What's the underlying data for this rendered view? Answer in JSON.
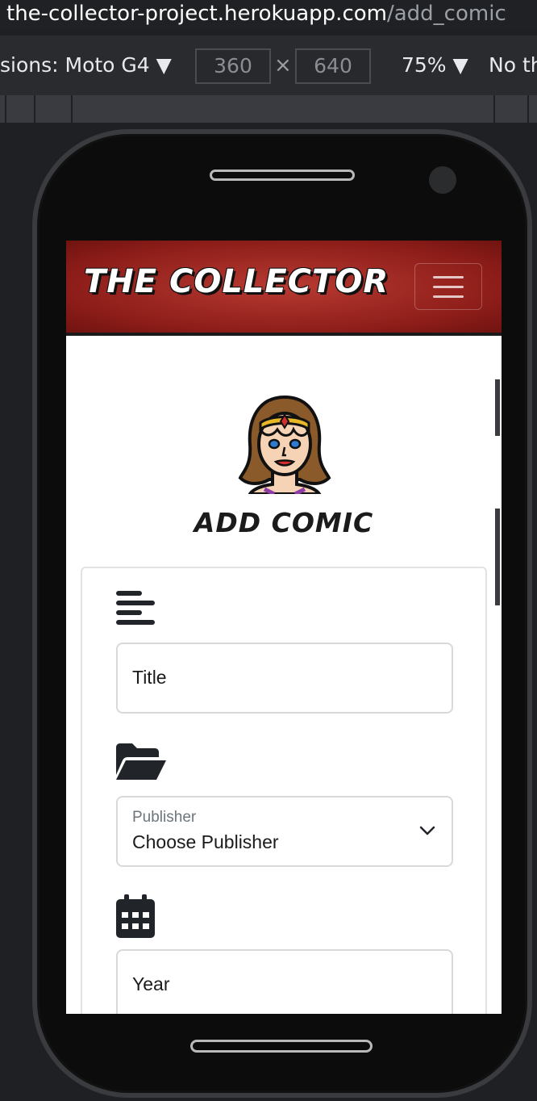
{
  "browser": {
    "url_host": "the-collector-project.herokuapp.com",
    "url_path": "/add_comic"
  },
  "devtools": {
    "device_label": "sions: Moto G4 ▼",
    "width": "360",
    "times": "×",
    "height": "640",
    "zoom": "75% ▼",
    "throttle": "No th"
  },
  "app": {
    "brand": "THE COLLECTOR",
    "page_title": "ADD COMIC",
    "fields": {
      "title_placeholder": "Title",
      "publisher_label": "Publisher",
      "publisher_value": "Choose Publisher",
      "year_placeholder": "Year"
    },
    "colors": {
      "navbar": "#8d1d19",
      "text": "#1b1b1b"
    },
    "icons": [
      "align-left-icon",
      "folder-open-icon",
      "calendar-icon",
      "wonder-woman-avatar-icon"
    ]
  }
}
